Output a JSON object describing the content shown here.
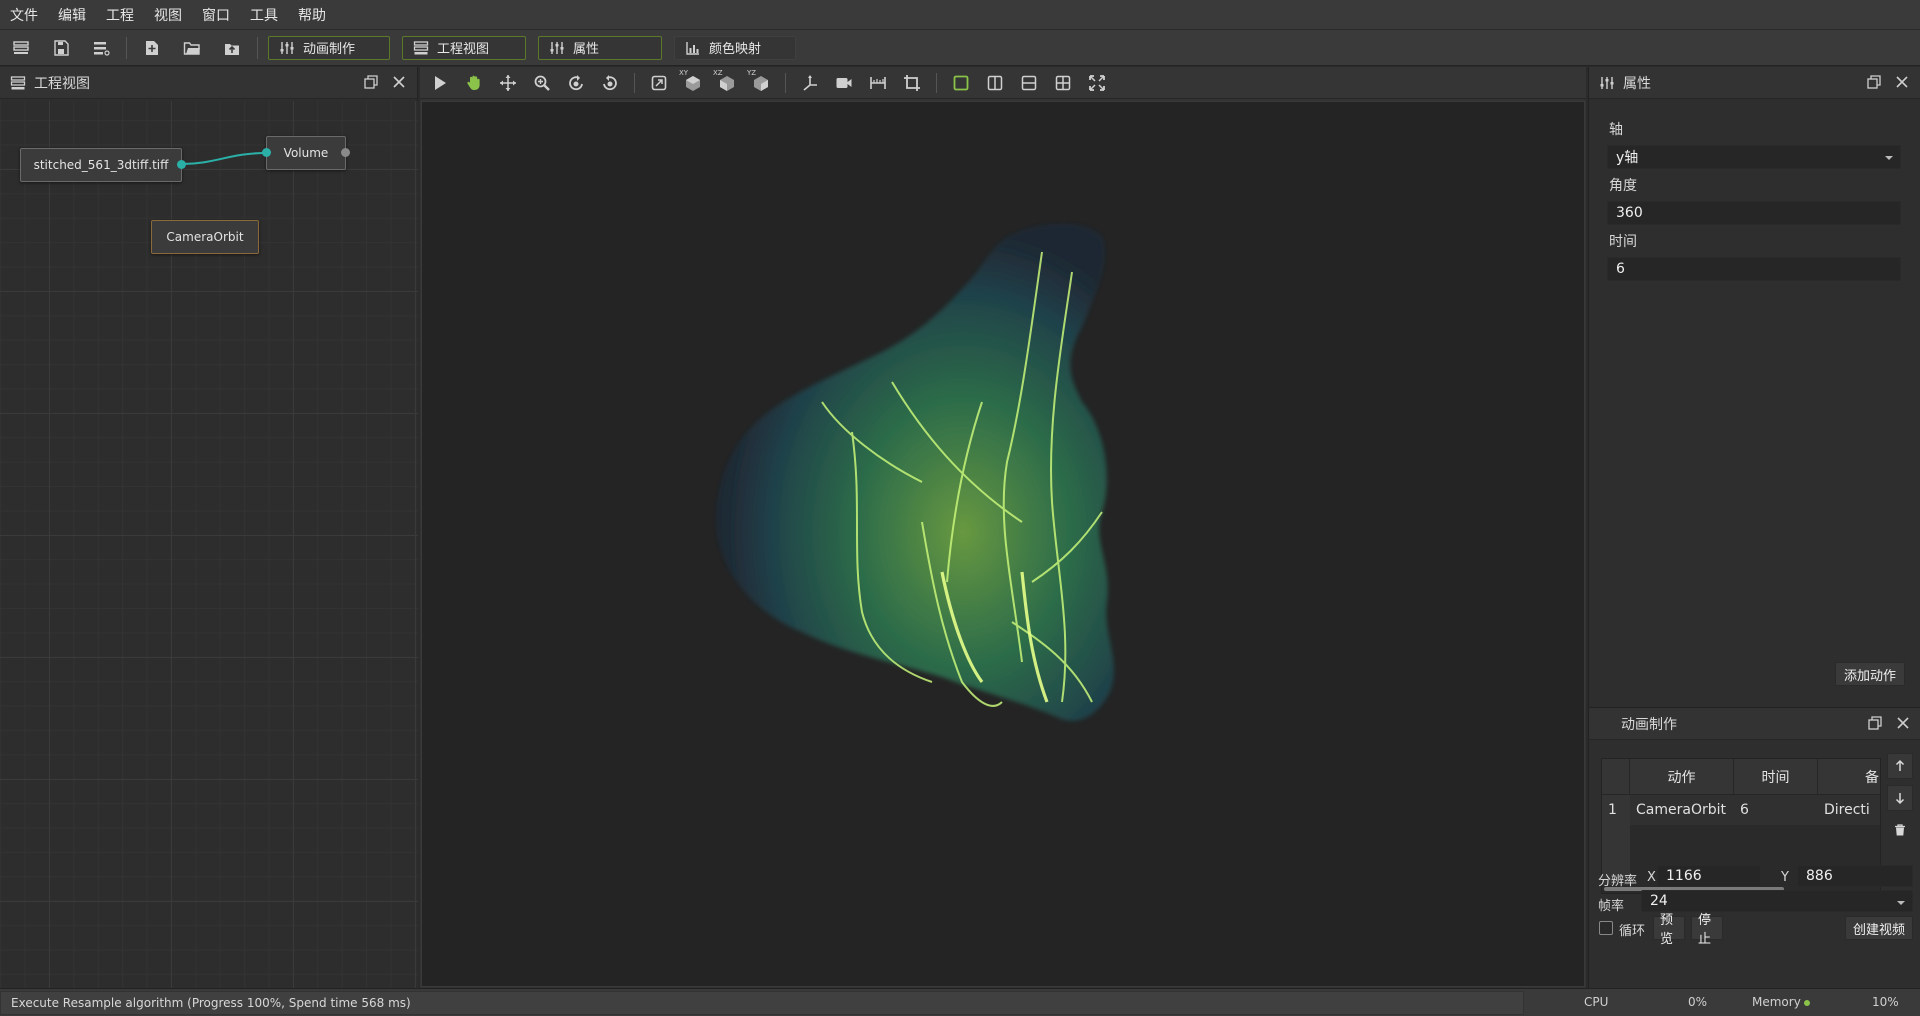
{
  "colors": {
    "accent": "#8bc34a",
    "node_link": "#2bb0a8",
    "panel_bg": "#2e2e2e",
    "viewport_bg": "#242424"
  },
  "menu": [
    "文件",
    "编辑",
    "工程",
    "视图",
    "窗口",
    "工具",
    "帮助"
  ],
  "toolbar": {
    "icons": [
      "list-icon",
      "save-icon",
      "list-settings-icon",
      "add-file-icon",
      "open-folder-icon",
      "export-icon"
    ],
    "tabs": [
      {
        "label": "动画制作",
        "icon": "sliders-icon",
        "active": true
      },
      {
        "label": "工程视图",
        "icon": "list-icon",
        "active": true
      },
      {
        "label": "属性",
        "icon": "sliders-icon",
        "active": true
      },
      {
        "label": "颜色映射",
        "icon": "chart-icon",
        "active": false
      }
    ]
  },
  "project_panel": {
    "title": "工程视图",
    "nodes": {
      "file": "stitched_561_3dtiff.tiff",
      "volume": "Volume",
      "camera": "CameraOrbit"
    }
  },
  "viewport_toolbar": {
    "icons": [
      "pointer-icon",
      "hand-icon",
      "move-icon",
      "zoom-icon",
      "rotate-left-icon",
      "rotate-right-icon",
      "fit-view-icon",
      "xy-view-icon",
      "xz-view-icon",
      "yz-view-icon",
      "axes-icon",
      "camera-icon",
      "ruler-icon",
      "crop-icon",
      "single-layout-icon",
      "split-vertical-icon",
      "split-horizontal-icon",
      "grid-layout-icon",
      "fullscreen-icon"
    ],
    "view_labels": {
      "xy": "XY",
      "xz": "XZ",
      "yz": "YZ"
    }
  },
  "properties_panel": {
    "title": "属性",
    "axis_label": "轴",
    "axis_value": "y轴",
    "angle_label": "角度",
    "angle_value": "360",
    "time_label": "时间",
    "time_value": "6",
    "add_action": "添加动作"
  },
  "animation_panel": {
    "title": "动画制作",
    "columns": [
      "动作",
      "时间",
      "备"
    ],
    "rows": [
      {
        "index": "1",
        "action": "CameraOrbit",
        "time": "6",
        "extra": "Directi"
      }
    ],
    "resolution_label": "分辨率",
    "x_label": "X",
    "x_value": "1166",
    "y_label": "Y",
    "y_value": "886",
    "fps_label": "帧率",
    "fps_value": "24",
    "loop_label": "循环",
    "preview": "预览",
    "stop": "停止",
    "create_video": "创建视频"
  },
  "status": {
    "message": "Execute Resample algorithm (Progress 100%, Spend time 568 ms)",
    "cpu_label": "CPU",
    "cpu_value": "0%",
    "memory_label": "Memory",
    "memory_value": "10%"
  }
}
